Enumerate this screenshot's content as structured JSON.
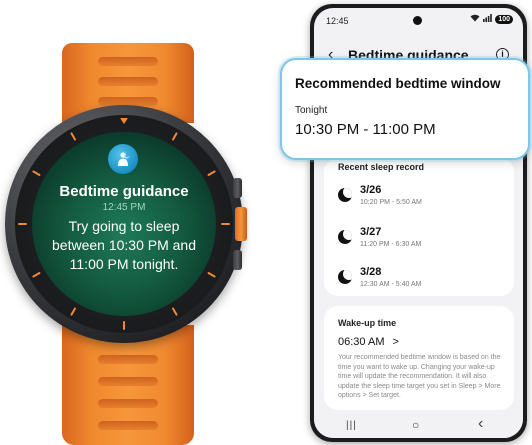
{
  "watch": {
    "app_icon": "sleep-person-icon",
    "title": "Bedtime guidance",
    "time": "12:45 PM",
    "message": "Try going to sleep between 10:30 PM and 11:00 PM tonight."
  },
  "phone": {
    "status": {
      "time": "12:45",
      "battery": "100"
    },
    "header": {
      "title": "Bedtime guidance",
      "back_icon": "back-chevron-icon",
      "info_icon": "info-icon"
    },
    "callout": {
      "heading": "Recommended bedtime window",
      "label": "Tonight",
      "value": "10:30 PM - 11:00 PM"
    },
    "recent": {
      "heading": "Recent sleep record",
      "items": [
        {
          "date": "3/26",
          "range": "10:20 PM - 5:50 AM"
        },
        {
          "date": "3/27",
          "range": "11:20 PM - 6:30 AM"
        },
        {
          "date": "3/28",
          "range": "12:30 AM - 5:40 AM"
        }
      ]
    },
    "wake": {
      "heading": "Wake-up time",
      "value": "06:30 AM",
      "chevron": ">",
      "description": "Your recommended bedtime window is based on the time you want to wake up. Changing your wake-up time will update the recommendation. It will also update the sleep time target you set in Sleep > More options > Set target."
    },
    "nav": {
      "recents": "|||",
      "home": "○",
      "back": "‹"
    }
  },
  "colors": {
    "strap": "#f08a30",
    "watch_screen": "#145c42",
    "callout_border": "#7cc6ea"
  }
}
